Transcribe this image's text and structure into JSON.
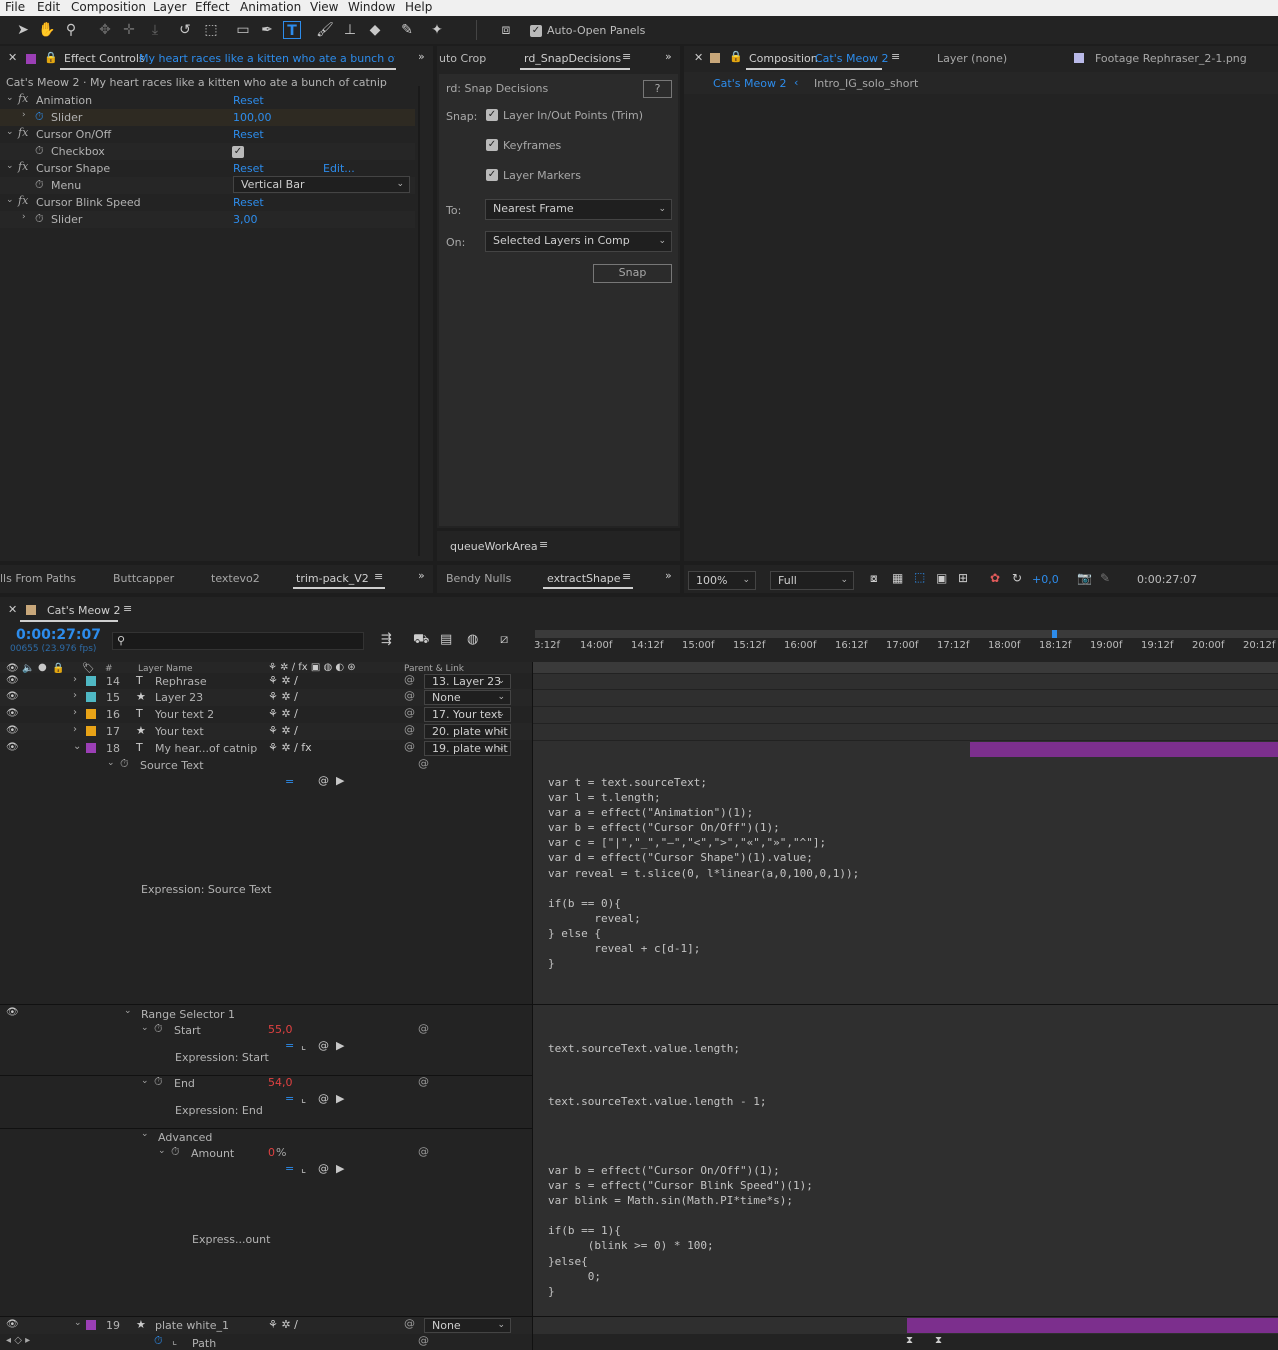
{
  "menu": [
    "File",
    "Edit",
    "Composition",
    "Layer",
    "Effect",
    "Animation",
    "View",
    "Window",
    "Help"
  ],
  "toolbar": {
    "auto_open": "Auto-Open Panels"
  },
  "effect_controls": {
    "tab": "Effect Controls",
    "tab_layer": "My heart races like a kitten who ate a bunch of catr",
    "crumb": "Cat's Meow 2 · My heart races like a kitten who ate a bunch of catnip",
    "rows": [
      {
        "name": "Animation",
        "fx": true,
        "value": "Reset"
      },
      {
        "name": "Slider",
        "fx": false,
        "value": "100,00"
      },
      {
        "name": "Cursor On/Off",
        "fx": true,
        "value": "Reset"
      },
      {
        "name": "Checkbox",
        "fx": false,
        "value": ""
      },
      {
        "name": "Cursor Shape",
        "fx": true,
        "value": "Reset",
        "extra": "Edit..."
      },
      {
        "name": "Menu",
        "fx": false,
        "value": "Vertical Bar"
      },
      {
        "name": "Cursor Blink Speed",
        "fx": true,
        "value": "Reset"
      },
      {
        "name": "Slider",
        "fx": false,
        "value": "3,00"
      }
    ]
  },
  "snap_panel": {
    "tab_prev": "uto Crop",
    "tab": "rd_SnapDecisions",
    "title": "rd: Snap Decisions",
    "help": "?",
    "snap_label": "Snap:",
    "opt1": "Layer In/Out Points (Trim)",
    "opt2": "Keyframes",
    "opt3": "Layer Markers",
    "to_label": "To:",
    "to_value": "Nearest Frame",
    "on_label": "On:",
    "on_value": "Selected Layers in Comp",
    "snap_btn": "Snap",
    "bottom_tab": "queueWorkArea"
  },
  "composition": {
    "tab": "Composition",
    "comp_name": "Cat's Meow 2",
    "layer_tab": "Layer (none)",
    "footage_tab": "Footage Rephraser_2-1.png",
    "flow1": "Cat's Meow 2",
    "flow2": "Intro_IG_solo_short"
  },
  "lower_tabs_left": [
    "lls From Paths",
    "Buttcapper",
    "textevo2",
    "trim-pack_V2"
  ],
  "lower_tabs_mid": [
    "Bendy Nulls",
    "extractShape"
  ],
  "viewer_bar": {
    "zoom": "100%",
    "res": "Full",
    "exposure": "+0,0",
    "time": "0:00:27:07"
  },
  "timeline": {
    "comp": "Cat's Meow 2",
    "time": "0:00:27:07",
    "frames": "00655 (23.976 fps)",
    "search_placeholder": "",
    "ticks": [
      "3:12f",
      "14:00f",
      "14:12f",
      "15:00f",
      "15:12f",
      "16:00f",
      "16:12f",
      "17:00f",
      "17:12f",
      "18:00f",
      "18:12f",
      "19:00f",
      "19:12f",
      "20:00f",
      "20:12f"
    ],
    "col_name": "Layer Name",
    "col_parent": "Parent & Link",
    "col_num": "#",
    "layers": [
      {
        "num": "14",
        "type": "T",
        "name": "Rephrase",
        "parent": "13. Layer 23",
        "color": "#4fb8c4"
      },
      {
        "num": "15",
        "type": "★",
        "name": "Layer 23",
        "parent": "None",
        "color": "#4fb8c4"
      },
      {
        "num": "16",
        "type": "T",
        "name": "Your text 2",
        "parent": "17. Your text",
        "color": "#e8a317"
      },
      {
        "num": "17",
        "type": "★",
        "name": "Your text",
        "parent": "20. plate whit",
        "color": "#e8a317"
      },
      {
        "num": "18",
        "type": "T",
        "name": "My hear...of catnip",
        "parent": "19. plate whit",
        "color": "#9b3fb5"
      }
    ],
    "source_text": "Source Text",
    "expr_source": "Expression: Source Text",
    "code1": "var t = text.sourceText;\nvar l = t.length;\nvar a = effect(\"Animation\")(1);\nvar b = effect(\"Cursor On/Off\")(1);\nvar c = [\"|\",\"_\",\"—\",\"<\",\">\",\"«\",\"»\",\"^\"];\nvar d = effect(\"Cursor Shape\")(1).value;\nvar reveal = t.slice(0, l*linear(a,0,100,0,1));\n\nif(b == 0){\n       reveal;\n} else {\n       reveal + c[d-1];\n}",
    "range_selector": "Range Selector 1",
    "start": "Start",
    "start_val": "55,0",
    "expr_start": "Expression: Start",
    "code2": "text.sourceText.value.length;",
    "end": "End",
    "end_val": "54,0",
    "expr_end": "Expression: End",
    "code3": "text.sourceText.value.length - 1;",
    "advanced": "Advanced",
    "amount": "Amount",
    "amount_val": "0",
    "amount_unit": "%",
    "expr_amount": "Express...ount",
    "code4": "var b = effect(\"Cursor On/Off\")(1);\nvar s = effect(\"Cursor Blink Speed\")(1);\nvar blink = Math.sin(Math.PI*time*s);\n\nif(b == 1){\n      (blink >= 0) * 100;\n}else{\n      0;\n}",
    "layer19": {
      "num": "19",
      "name": "plate white_1",
      "parent": "None"
    },
    "path": "Path"
  },
  "colors": {
    "accent": "#2d8ceb",
    "purple": "#9b3fb5",
    "green": "#3fb53f",
    "red": "#e04141"
  }
}
